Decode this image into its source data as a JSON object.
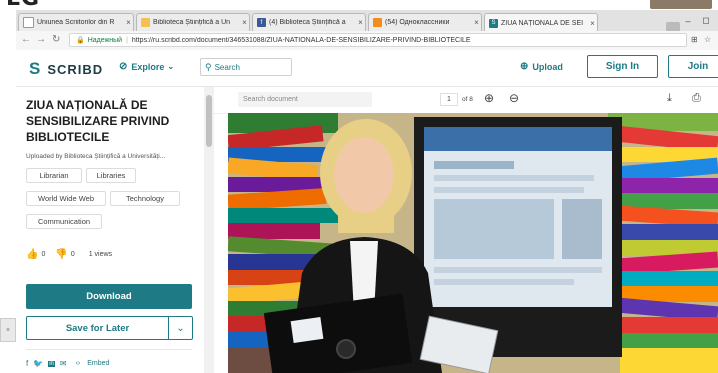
{
  "colors": {
    "accent": "#1e7b85",
    "secure_green": "#0a8043"
  },
  "bezel_text": "LG",
  "browser": {
    "tabs": [
      {
        "title": "Uniunea Scriitorilor din R",
        "favicon": "page-icon"
      },
      {
        "title": "Biblioteca Științifică a Un",
        "favicon": "bookmark-icon"
      },
      {
        "title": "(4) Biblioteca Științifică a",
        "favicon": "facebook-icon"
      },
      {
        "title": "(54) Одноклассники",
        "favicon": "odnoklassniki-icon"
      },
      {
        "title": "ZIUA NAȚIONALĂ DE SEI",
        "favicon": "scribd-icon"
      }
    ],
    "window_controls": {
      "minimize": "–",
      "restore": "◻"
    },
    "address": {
      "secure_label": "Надежный",
      "url": "https://ru.scribd.com/document/346531088/ZIUA-NATIONALA-DE-SENSIBILIZARE-PRIVIND-BIBLIOTECILE"
    }
  },
  "header": {
    "logo": "SCRIBD",
    "explore": "Explore",
    "search_placeholder": "Search",
    "upload": "Upload",
    "sign_in": "Sign In",
    "join": "Join"
  },
  "document": {
    "title": "ZIUA NAȚIONALĂ DE SENSIBILIZARE PRIVIND BIBLIOTECILE",
    "uploaded_by": "Uploaded by Biblioteca Științifică a Universități...",
    "tags": [
      "Librarian",
      "Libraries",
      "World Wide Web",
      "Technology",
      "Communication"
    ],
    "upvotes": "0",
    "downvotes": "0",
    "views": "1 views",
    "download": "Download",
    "save_for_later": "Save for Later",
    "embed": "Embed"
  },
  "viewer": {
    "search_placeholder": "Search document",
    "page_current": "1",
    "page_of": "of 8"
  }
}
